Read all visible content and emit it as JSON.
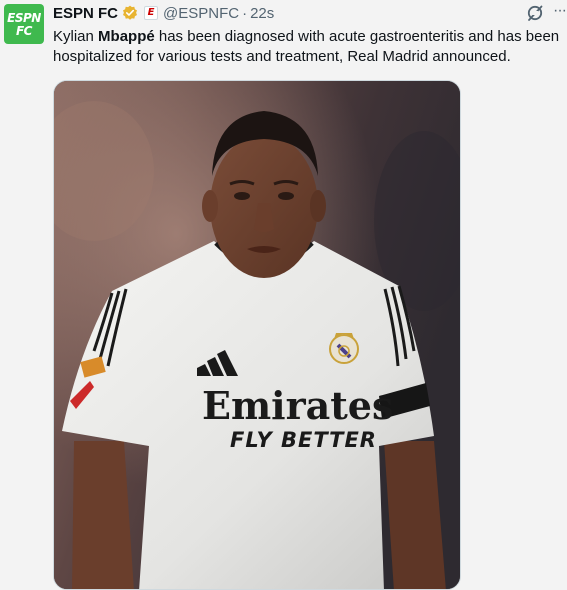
{
  "tweet": {
    "author": {
      "display_name": "ESPN FC",
      "handle": "@ESPNFC",
      "avatar_line1": "ESPN",
      "avatar_line2": "FC",
      "verified": true,
      "affiliate_badge": "E"
    },
    "separator": "·",
    "timestamp": "22s",
    "text": {
      "part1": "Kylian ",
      "bold": "Mbappé",
      "part2": " has been diagnosed with acute gastroenteritis and has been hospitalized for various tests and treatment, Real Madrid announced."
    },
    "media": {
      "sponsor_line1": "Emirates",
      "sponsor_line2": "FLY BETTER"
    },
    "more_label": "···"
  },
  "colors": {
    "avatar": "#3fb94e",
    "verified": "#e8b431",
    "secondary_text": "#536471",
    "primary_text": "#0f1419",
    "espn_red": "#cc0000",
    "background": "#f3f3f3"
  },
  "icons": [
    "espn-fc-avatar",
    "verified-gold-badge-icon",
    "espn-affiliate-icon",
    "grok-icon",
    "more-icon"
  ]
}
